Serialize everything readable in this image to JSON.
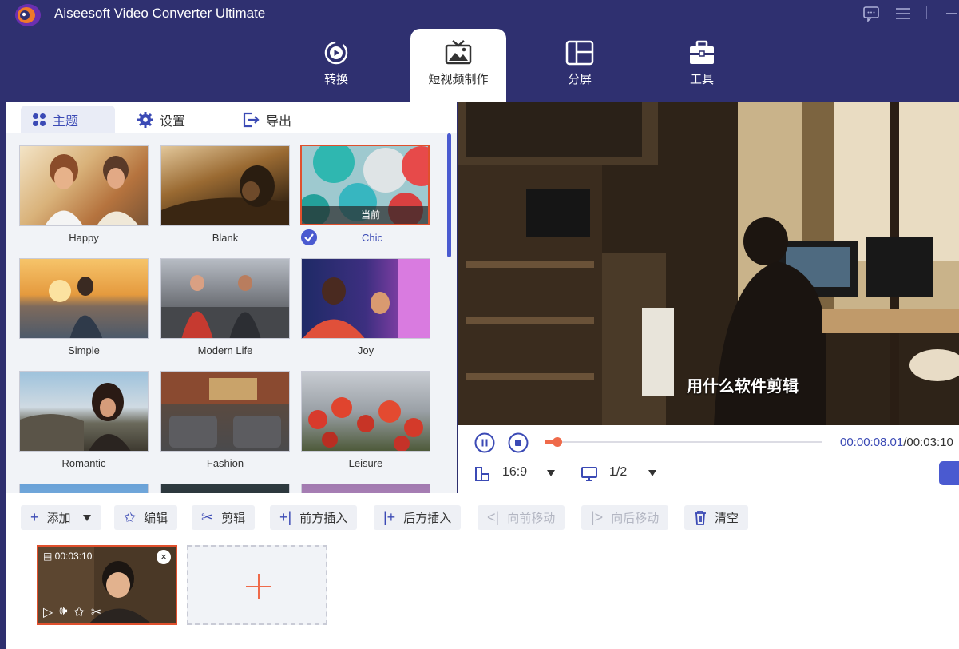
{
  "app": {
    "title": "Aiseesoft Video Converter Ultimate"
  },
  "nav": {
    "tabs": [
      {
        "label": "转换",
        "icon": "convert-icon"
      },
      {
        "label": "短视频制作",
        "icon": "mv-icon"
      },
      {
        "label": "分屏",
        "icon": "split-screen-icon"
      },
      {
        "label": "工具",
        "icon": "toolbox-icon"
      }
    ]
  },
  "subtabs": {
    "theme": "主题",
    "settings": "设置",
    "export": "导出"
  },
  "themes": [
    {
      "name": "Happy"
    },
    {
      "name": "Blank"
    },
    {
      "name": "Chic",
      "current_label": "当前"
    },
    {
      "name": "Simple"
    },
    {
      "name": "Modern Life"
    },
    {
      "name": "Joy"
    },
    {
      "name": "Romantic"
    },
    {
      "name": "Fashion"
    },
    {
      "name": "Leisure"
    }
  ],
  "preview": {
    "subtitle": "用什么软件剪辑"
  },
  "player": {
    "current_time": "00:00:08.01",
    "total_time": "/00:03:10",
    "progress_fraction": 0.045,
    "aspect_ratio": "16:9",
    "screen_ratio": "1/2"
  },
  "toolbar": {
    "add": "添加",
    "edit": "编辑",
    "trim": "剪辑",
    "insert_before": "前方插入",
    "insert_after": "后方插入",
    "move_forward": "向前移动",
    "move_backward": "向后移动",
    "clear": "清空"
  },
  "clip": {
    "duration": "00:03:10"
  },
  "colors": {
    "accent": "#3b4ab5",
    "highlight": "#e0502d",
    "nav_bg": "#2f3070"
  }
}
